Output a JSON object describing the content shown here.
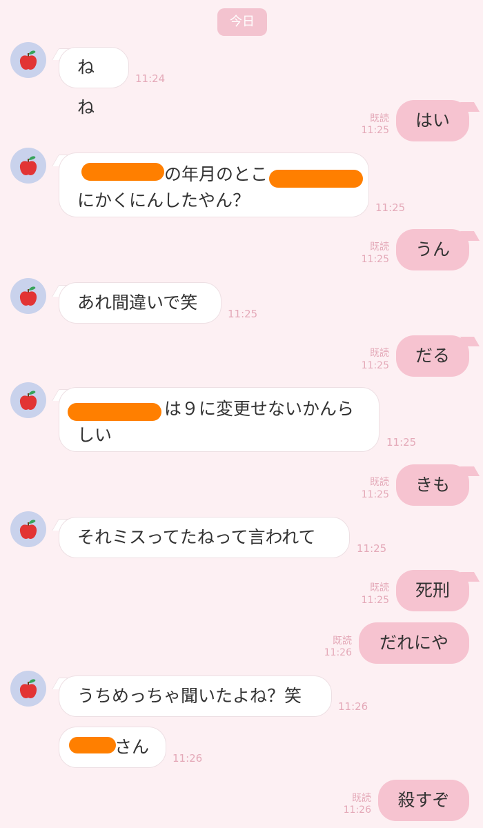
{
  "date_label": "今日",
  "messages": [
    {
      "side": "left",
      "text": "ねね",
      "time": "11:24"
    },
    {
      "side": "right",
      "text": "はい",
      "read": "既読",
      "time": "11:25"
    },
    {
      "side": "left",
      "line1_mid": "の年月のとこ",
      "line2": "にかくにんしたやん？",
      "time": "11:25"
    },
    {
      "side": "right",
      "text": "うん",
      "read": "既読",
      "time": "11:25"
    },
    {
      "side": "left",
      "text": "あれ間違いで笑",
      "time": "11:25"
    },
    {
      "side": "right",
      "text": "だる",
      "read": "既読",
      "time": "11:25"
    },
    {
      "side": "left",
      "line1_tail": "は９に変更せないかんら",
      "line2": "しい",
      "time": "11:25"
    },
    {
      "side": "right",
      "text": "きも",
      "read": "既読",
      "time": "11:25"
    },
    {
      "side": "left",
      "text": "それミスってたねって言われて",
      "time": "11:25"
    },
    {
      "side": "right",
      "text": "死刑",
      "read": "既読",
      "time": "11:25"
    },
    {
      "side": "right",
      "text": "だれにや",
      "read": "既読",
      "time": "11:26"
    },
    {
      "side": "left",
      "text": "うちめっちゃ聞いたよね？笑",
      "time": "11:26"
    },
    {
      "side": "left",
      "text_tail": "さん",
      "time": "11:26"
    },
    {
      "side": "right",
      "text": "殺すぞ",
      "read": "既読",
      "time": "11:26"
    }
  ],
  "colors": {
    "background": "#fdf0f3",
    "my_bubble": "#f6c3d0",
    "their_bubble": "#ffffff",
    "redaction": "#ff7f00",
    "avatar_bg": "#c9d2ec"
  },
  "avatar_icon": "apple-icon"
}
